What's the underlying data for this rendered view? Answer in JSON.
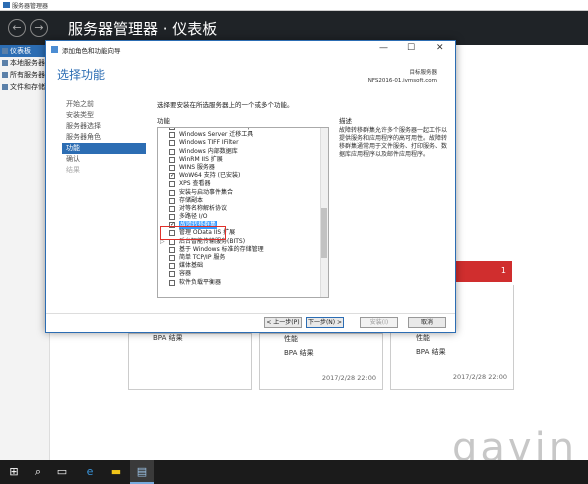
{
  "window": {
    "app_title": "服务器管理器",
    "header_title": "服务器管理器 · 仪表板"
  },
  "sidebar": {
    "items": [
      {
        "label": "仪表板",
        "selected": true
      },
      {
        "label": "本地服务器"
      },
      {
        "label": "所有服务器"
      },
      {
        "label": "文件和存储服务"
      }
    ]
  },
  "tiles": [
    {
      "label": "BPA 结果"
    },
    {
      "label1": "性能",
      "label2": "BPA 结果",
      "date": "2017/2/28 22:00"
    },
    {
      "label1": "性能",
      "label2": "BPA 结果",
      "date": "2017/2/28 22:00"
    }
  ],
  "tile_alert_count": "1",
  "dialog": {
    "title": "添加角色和功能向导",
    "heading": "选择功能",
    "target_label": "目标服务器",
    "target_server": "NFS2016-01.ivmsoft.com",
    "nav": [
      "开始之前",
      "安装类型",
      "服务器选择",
      "服务器角色",
      "功能",
      "确认",
      "结果"
    ],
    "nav_selected": 4,
    "instruction": "选择要安装在所选服务器上的一个或多个功能。",
    "features_label": "功能",
    "description_label": "描述",
    "description": "故障转移群集允许多个服务器一起工作以提供服务和应用程序的高可用性。故障转移群集通常用于文件服务、打印服务、数据库应用程序以及邮件应用程序。",
    "features": [
      {
        "label": "Windows Server Backup",
        "checked": false,
        "expand": false
      },
      {
        "label": "Windows Server 迁移工具",
        "checked": false,
        "expand": false
      },
      {
        "label": "Windows TIFF IFilter",
        "checked": false,
        "expand": false
      },
      {
        "label": "Windows 内部数据库",
        "checked": false,
        "expand": false
      },
      {
        "label": "WinRM IIS 扩展",
        "checked": false,
        "expand": false
      },
      {
        "label": "WINS 服务器",
        "checked": false,
        "expand": false
      },
      {
        "label": "WoW64 支持 (已安装)",
        "checked": true,
        "expand": false
      },
      {
        "label": "XPS 查看器",
        "checked": false,
        "expand": false
      },
      {
        "label": "安装与启动事件集合",
        "checked": false,
        "expand": false
      },
      {
        "label": "存储副本",
        "checked": false,
        "expand": false
      },
      {
        "label": "对等名称解析协议",
        "checked": false,
        "expand": false
      },
      {
        "label": "多路径 I/O",
        "checked": false,
        "expand": false
      },
      {
        "label": "故障转移群集",
        "checked": true,
        "expand": false,
        "highlighted": true
      },
      {
        "label": "管理 OData IIS 扩展",
        "checked": false,
        "expand": false
      },
      {
        "label": "后台智能传输服务(BITS)",
        "checked": false,
        "expand": true
      },
      {
        "label": "基于 Windows 标准的存储管理",
        "checked": false,
        "expand": false
      },
      {
        "label": "简单 TCP/IP 服务",
        "checked": false,
        "expand": false
      },
      {
        "label": "媒体基础",
        "checked": false,
        "expand": false
      },
      {
        "label": "容器",
        "checked": false,
        "expand": false
      },
      {
        "label": "软件负载平衡器",
        "checked": false,
        "expand": false
      }
    ],
    "buttons": {
      "prev": "< 上一步(P)",
      "next": "下一步(N) >",
      "install": "安装(I)",
      "cancel": "取消"
    }
  },
  "taskbar": {
    "icons": [
      "windows-icon",
      "search-icon",
      "task-view-icon",
      "edge-icon",
      "file-explorer-icon",
      "server-manager-icon"
    ]
  },
  "watermark": "gavin",
  "colors": {
    "accent": "#2c6db3",
    "header_bg": "#1f2327",
    "alert_red": "#d02e2e",
    "highlight_box": "#e0302a",
    "selection": "#3399ff"
  }
}
